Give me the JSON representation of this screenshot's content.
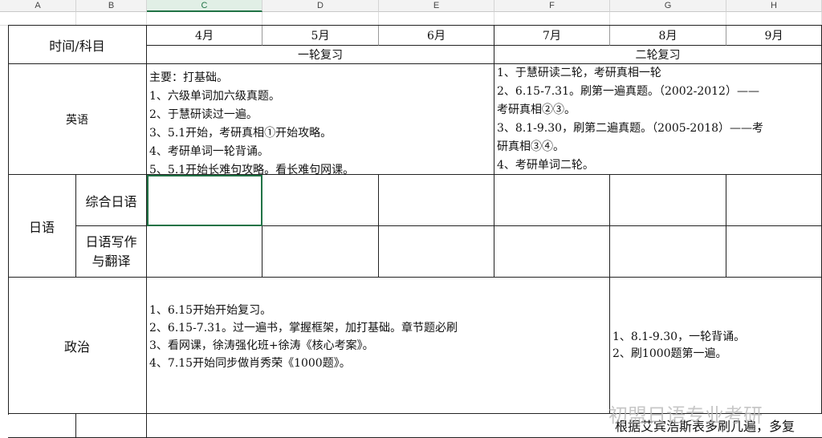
{
  "columns": [
    "A",
    "B",
    "C",
    "D",
    "E",
    "F",
    "G",
    "H"
  ],
  "header": {
    "time_subject": "时间/科目",
    "months": [
      "4月",
      "5月",
      "6月",
      "7月",
      "8月",
      "9月"
    ],
    "round1": "一轮复习",
    "round2": "二轮复习"
  },
  "english": {
    "label": "英语",
    "round1": [
      "主要：打基础。",
      "1、六级单词加六级真题。",
      "2、于慧研读过一遍。",
      "3、5.1开始，考研真相①开始攻略。",
      "4、考研单词一轮背诵。",
      "5、5.1开始长难句攻略。看长难句网课。"
    ],
    "round2": [
      "1、于慧研读二轮，考研真相一轮",
      "2、6.15-7.31。刷第一遍真题。（2002-2012）——",
      "考研真相②③。",
      "3、8.1-9.30，刷第二遍真题。（2005-2018）——考",
      "研真相③④。",
      "4、考研单词二轮。"
    ]
  },
  "japanese": {
    "label": "日语",
    "sub1": "综合日语",
    "sub2a": "日语写作",
    "sub2b": "与翻译"
  },
  "politics": {
    "label": "政治",
    "round1": [
      "1、6.15开始开始复习。",
      "2、6.15-7.31。过一遍书，掌握框架，加打基础。章节题必刷",
      "3、看网课，徐涛强化班+徐涛《核心考案》。",
      "4、7.15开始同步做肖秀荣《1000题》。"
    ],
    "round2": [
      "1、8.1-9.30，一轮背诵。",
      "2、刷1000题第一遍。"
    ]
  },
  "bottom_text": "根据艾宾浩斯表多刷几遍，多复",
  "watermark": "初盟日语专业考研"
}
